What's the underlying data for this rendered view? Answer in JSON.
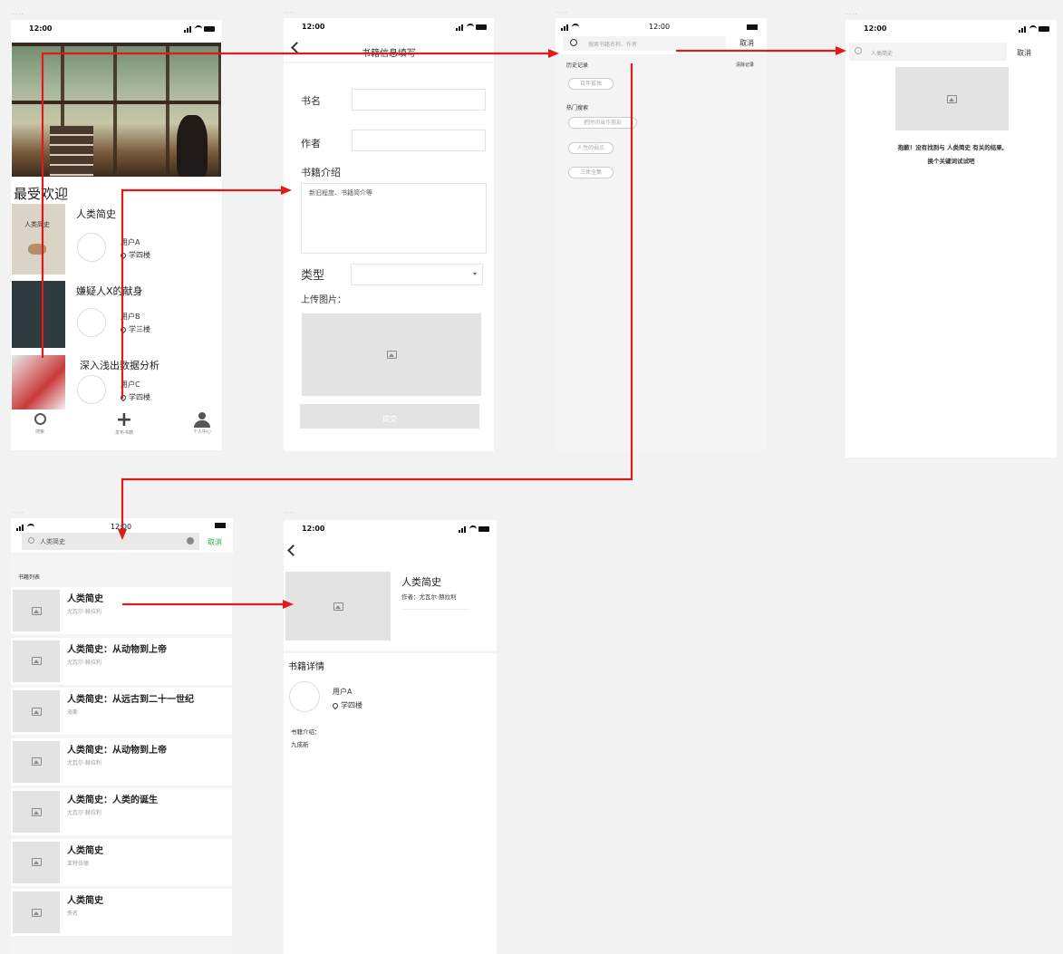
{
  "status_time": "12:00",
  "screen1": {
    "section_title": "最受欢迎",
    "books": [
      {
        "title": "人类简史",
        "user": "用户A",
        "location": "学四楼"
      },
      {
        "title": "嫌疑人X的献身",
        "user": "用户B",
        "location": "学三楼"
      },
      {
        "title": "深入浅出数据分析",
        "user": "用户C",
        "location": "学四楼"
      }
    ],
    "cover_text": "人类简史",
    "nav": [
      {
        "icon": "search-icon",
        "label": "搜索"
      },
      {
        "icon": "plus-icon",
        "label": "发布书籍"
      },
      {
        "icon": "user-icon",
        "label": "个人中心"
      }
    ]
  },
  "screen2": {
    "title": "书籍信息填写",
    "label_name": "书名",
    "label_author": "作者",
    "label_intro": "书籍介绍",
    "intro_placeholder": "新旧程度、书籍简介等",
    "label_category": "类型",
    "label_upload": "上传图片：",
    "submit": "提交"
  },
  "screen3": {
    "search_placeholder": "搜索书籍名称、作者",
    "cancel": "取消",
    "history_title": "历史记录",
    "clear_history": "清除记录",
    "history_chips": [
      "百年孤独"
    ],
    "hot_title": "热门搜索",
    "hot_chips": [
      "把时间当作朋友",
      "人性的弱点",
      "三体全集"
    ]
  },
  "screen4": {
    "search_value": "人类简史",
    "cancel": "取消",
    "empty_line1": "抱歉！没有找到与 人类简史 有关的结果,",
    "empty_line2": "换个关键词试试吧"
  },
  "screen5": {
    "search_value": "人类简史",
    "cancel": "取消",
    "list_title": "书籍列表",
    "results": [
      {
        "title": "人类简史",
        "author": "尤瓦尔·赫拉利"
      },
      {
        "title": "人类简史：从动物到上帝",
        "author": "尤瓦尔·赫拉利"
      },
      {
        "title": "人类简史：从远古到二十一世纪",
        "author": "海斯"
      },
      {
        "title": "人类简史：从动物到上帝",
        "author": "尤瓦尔·赫拉利"
      },
      {
        "title": "人类简史：人类的诞生",
        "author": "尤瓦尔·赫拉利"
      },
      {
        "title": "人类简史",
        "author": "亚特伍德"
      },
      {
        "title": "人类简史",
        "author": "佚名"
      }
    ]
  },
  "screen6": {
    "book_title": "人类简史",
    "author_line": "作者：尤瓦尔·赫拉利",
    "section_title": "书籍详情",
    "user": "用户A",
    "location": "学四楼",
    "intro_label": "书籍介绍：",
    "intro_value": "九成新"
  },
  "colors": {
    "arrow": "#e01b1b",
    "accent_green": "#2bb24c",
    "placeholder": "#e3e3e3"
  }
}
